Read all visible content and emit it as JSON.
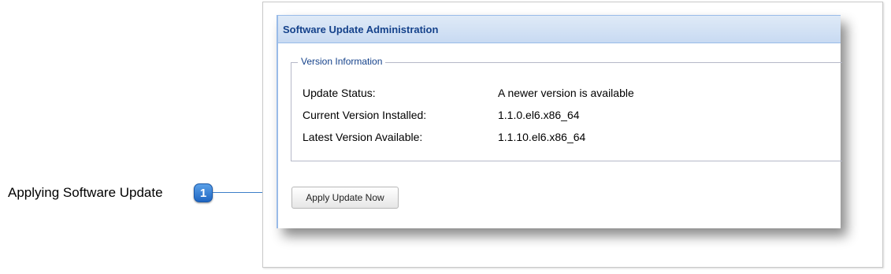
{
  "callout": {
    "label": "Applying Software Update",
    "badge_number": "1"
  },
  "panel": {
    "title": "Software Update Administration"
  },
  "version_info": {
    "legend": "Version Information",
    "rows": [
      {
        "label": "Update Status:",
        "value": "A newer version is available"
      },
      {
        "label": "Current Version Installed:",
        "value": "1.1.0.el6.x86_64"
      },
      {
        "label": "Latest Version Available:",
        "value": "1.1.10.el6.x86_64"
      }
    ]
  },
  "actions": {
    "apply_label": "Apply Update Now"
  },
  "colors": {
    "header_text": "#15428b",
    "panel_border": "#99bbe8",
    "callout_badge": "#1f66c2"
  }
}
